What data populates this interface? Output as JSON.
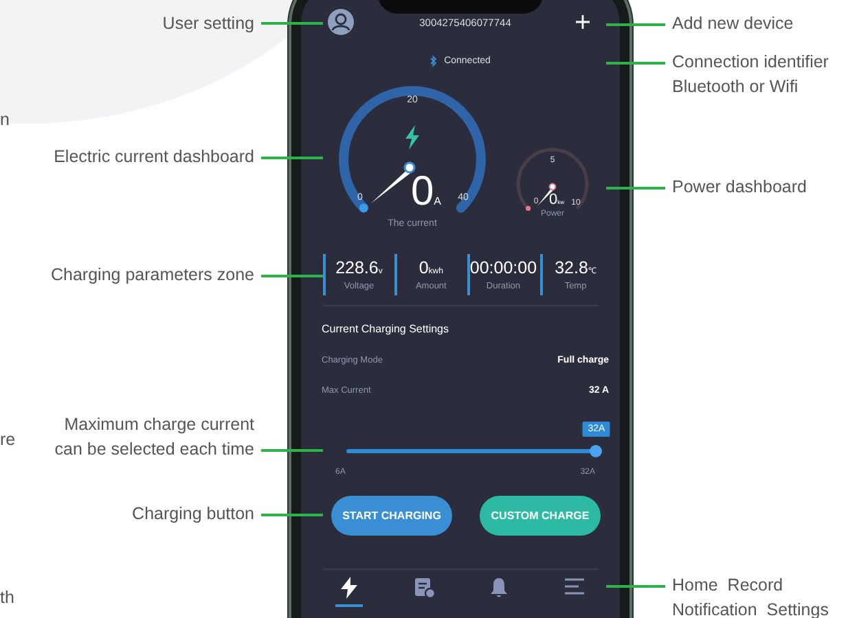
{
  "callouts_left": [
    {
      "lines": [
        "User setting"
      ]
    },
    {
      "lines": [
        "Electric current dashboard"
      ]
    },
    {
      "lines": [
        "Charging parameters zone"
      ]
    },
    {
      "lines": [
        "Maximum charge current",
        "can be selected each time"
      ]
    },
    {
      "lines": [
        "Charging button"
      ]
    }
  ],
  "cut_fragments": [
    "n",
    "re",
    "th"
  ],
  "callouts_right": [
    {
      "lines": [
        "Add new device"
      ]
    },
    {
      "lines": [
        "Connection identifier",
        "Bluetooth or Wifi"
      ]
    },
    {
      "lines": [
        "Power dashboard"
      ]
    },
    {
      "lines": [
        "Home  Record",
        "Notification  Settings"
      ]
    }
  ],
  "app": {
    "device_id": "3004275406077744",
    "connection": "Connected",
    "current_gauge": {
      "ticks": [
        "0",
        "20",
        "40"
      ],
      "value": "0",
      "unit": "A",
      "label": "The current"
    },
    "power_gauge": {
      "ticks": [
        "0",
        "5",
        "10"
      ],
      "value": "0",
      "unit": "kw",
      "label": "Power"
    },
    "stats": [
      {
        "value": "228.6",
        "unit": "v",
        "label": "Voltage"
      },
      {
        "value": "0",
        "unit": "kwh",
        "label": "Amount"
      },
      {
        "value": "00:00:00",
        "label": "Duration"
      },
      {
        "value": "32.8",
        "unit": "℃",
        "label": "Temp"
      }
    ],
    "settings": {
      "title": "Current Charging Settings",
      "rows": [
        {
          "label": "Charging Mode",
          "value": "Full charge"
        },
        {
          "label": "Max Current",
          "value": "32 A"
        }
      ]
    },
    "slider": {
      "level": 1,
      "tooltip": "32A",
      "min": "6A",
      "max": "32A"
    },
    "buttons": [
      {
        "label": "START CHARGING",
        "kind": "primary"
      },
      {
        "label": "CUSTOM CHARGE",
        "kind": "secondary"
      }
    ],
    "nav": [
      {
        "kind": "charge",
        "selected": true
      },
      {
        "kind": "record",
        "selected": false
      },
      {
        "kind": "notification",
        "selected": false
      },
      {
        "kind": "menu",
        "selected": false
      }
    ]
  }
}
